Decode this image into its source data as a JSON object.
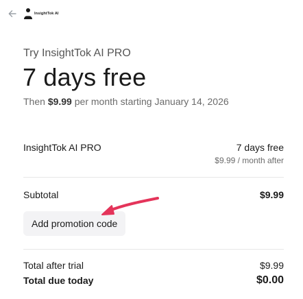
{
  "header": {
    "back_icon": "arrow-left-icon",
    "logo_text": "InsightTok AI"
  },
  "offer": {
    "try_line": "Try InsightTok AI PRO",
    "headline": "7 days free",
    "then_prefix": "Then",
    "then_price": "$9.99",
    "then_suffix": "per month starting January 14, 2026"
  },
  "line_item": {
    "name": "InsightTok AI PRO",
    "trial": "7 days free",
    "after": "$9.99 / month after"
  },
  "subtotal": {
    "label": "Subtotal",
    "value": "$9.99"
  },
  "promo": {
    "label": "Add promotion code"
  },
  "totals": {
    "after_trial_label": "Total after trial",
    "after_trial_value": "$9.99",
    "due_today_label": "Total due today",
    "due_today_value": "$0.00"
  },
  "colors": {
    "annotation_arrow": "#e4345a"
  }
}
